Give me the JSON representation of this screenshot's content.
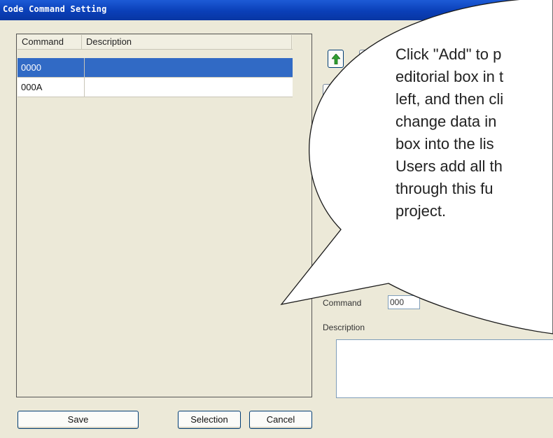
{
  "window": {
    "title": "Code Command Setting"
  },
  "list": {
    "columns": [
      "Command",
      "Description"
    ],
    "rows": [
      {
        "command": "0000",
        "description": "",
        "selected": true
      },
      {
        "command": "000A",
        "description": "",
        "selected": false
      }
    ]
  },
  "buttons": {
    "save": "Save",
    "selection": "Selection",
    "cancel": "Cancel"
  },
  "form": {
    "command_label": "Command",
    "command_value": "000",
    "description_label": "Description",
    "description_value": ""
  },
  "callout": {
    "lines": [
      "Click \"Add\" to p",
      "editorial box in t",
      "left, and then cli",
      "change data in",
      "box into the lis",
      "Users add all th",
      "through this fu",
      "project."
    ]
  },
  "colors": {
    "titlebar": "#0a3fb8",
    "selection": "#316ac5",
    "window_bg": "#ece9d8"
  },
  "icons": {
    "move_up": "green-up-arrow-icon"
  }
}
